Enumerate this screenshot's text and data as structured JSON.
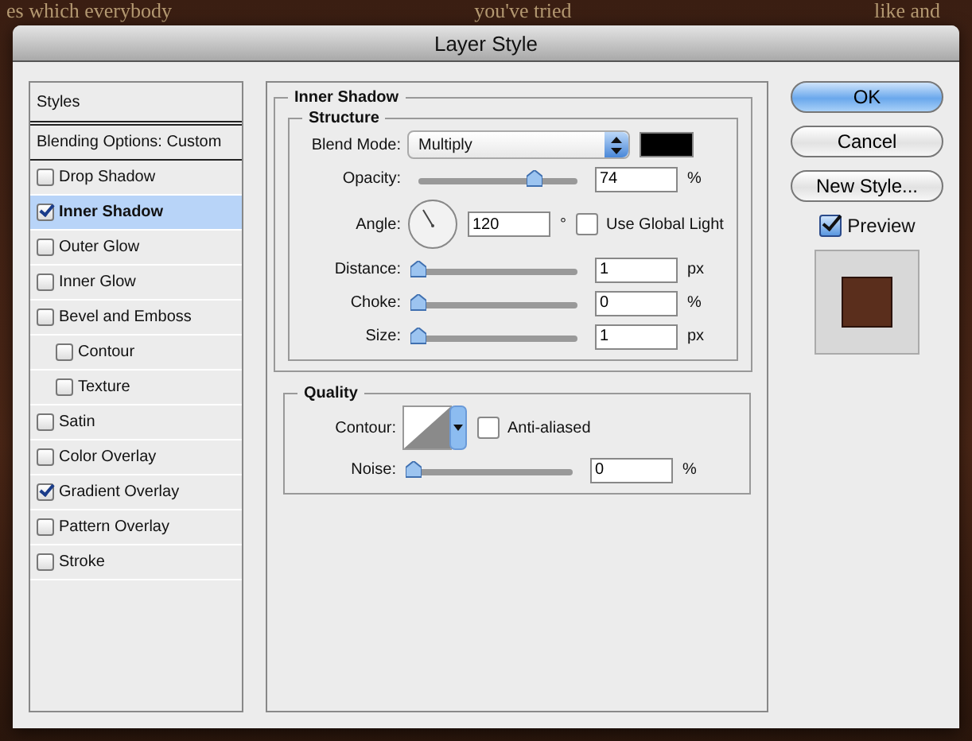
{
  "background_texts": [
    "es which everybody",
    "you've tried",
    "like and"
  ],
  "window": {
    "title": "Layer Style"
  },
  "styles": {
    "header": "Styles",
    "items": [
      {
        "kind": "option",
        "label": "Blending Options: Custom",
        "selected": false
      },
      {
        "kind": "check",
        "label": "Drop Shadow",
        "checked": false,
        "selected": false
      },
      {
        "kind": "check",
        "label": "Inner Shadow",
        "checked": true,
        "selected": true
      },
      {
        "kind": "check",
        "label": "Outer Glow",
        "checked": false,
        "selected": false
      },
      {
        "kind": "check",
        "label": "Inner Glow",
        "checked": false,
        "selected": false
      },
      {
        "kind": "check",
        "label": "Bevel and Emboss",
        "checked": false,
        "selected": false,
        "children": [
          {
            "kind": "check",
            "label": "Contour",
            "checked": false,
            "selected": false
          },
          {
            "kind": "check",
            "label": "Texture",
            "checked": false,
            "selected": false
          }
        ]
      },
      {
        "kind": "check",
        "label": "Satin",
        "checked": false,
        "selected": false
      },
      {
        "kind": "check",
        "label": "Color Overlay",
        "checked": false,
        "selected": false
      },
      {
        "kind": "check",
        "label": "Gradient Overlay",
        "checked": true,
        "selected": false
      },
      {
        "kind": "check",
        "label": "Pattern Overlay",
        "checked": false,
        "selected": false
      },
      {
        "kind": "check",
        "label": "Stroke",
        "checked": false,
        "selected": false
      }
    ]
  },
  "inner_shadow": {
    "title": "Inner Shadow",
    "structure": {
      "title": "Structure",
      "blend_mode": {
        "label": "Blend Mode:",
        "value": "Multiply",
        "color": "#000000"
      },
      "opacity": {
        "label": "Opacity:",
        "level": 0.73,
        "value": "74",
        "unit": "%"
      },
      "angle": {
        "label": "Angle:",
        "value": "120",
        "unit": "°",
        "use_global_light": {
          "label": "Use Global Light",
          "checked": false
        }
      },
      "distance": {
        "label": "Distance:",
        "level": 0,
        "value": "1",
        "unit": "px"
      },
      "choke": {
        "label": "Choke:",
        "level": 0,
        "value": "0",
        "unit": "%"
      },
      "size": {
        "label": "Size:",
        "level": 0,
        "value": "1",
        "unit": "px"
      }
    },
    "quality": {
      "title": "Quality",
      "contour": {
        "label": "Contour:",
        "anti_aliased": {
          "label": "Anti-aliased",
          "checked": false
        }
      },
      "noise": {
        "label": "Noise:",
        "level": 0,
        "value": "0",
        "unit": "%"
      }
    }
  },
  "buttons": [
    {
      "label": "OK",
      "default": true
    },
    {
      "label": "Cancel",
      "default": false
    },
    {
      "label": "New Style...",
      "default": false
    }
  ],
  "preview": {
    "label": "Preview",
    "checked": true
  }
}
